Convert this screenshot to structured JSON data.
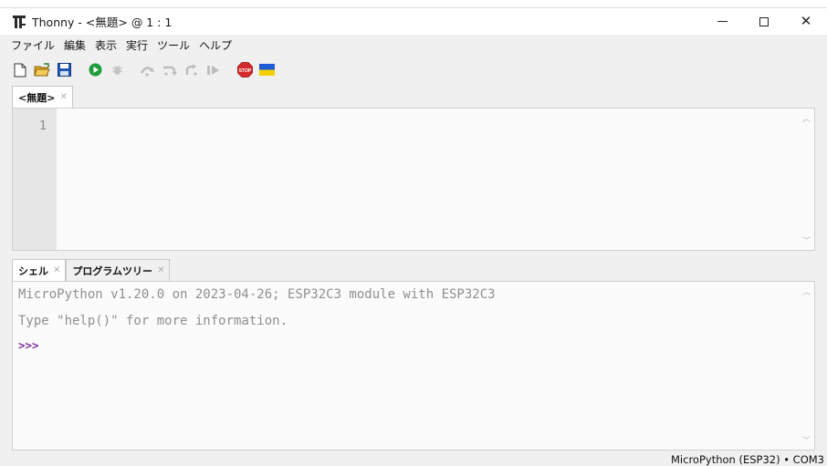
{
  "window": {
    "title": "Thonny  -  <無題>  @  1 : 1"
  },
  "menu": {
    "items": [
      {
        "label": "ファイル"
      },
      {
        "label": "編集"
      },
      {
        "label": "表示"
      },
      {
        "label": "実行"
      },
      {
        "label": "ツール"
      },
      {
        "label": "ヘルプ"
      }
    ]
  },
  "toolbar": {
    "icons": [
      "new-file-icon",
      "open-file-icon",
      "save-icon",
      "run-icon",
      "debug-icon",
      "step-over-icon",
      "step-into-icon",
      "step-out-icon",
      "resume-icon",
      "stop-icon",
      "ukraine-flag-icon"
    ],
    "stop_label": "STOP",
    "colors": {
      "run": "#1f9d3a",
      "stop": "#d62b2b",
      "save": "#2456b4",
      "flag_blue": "#1f5bd6",
      "flag_yellow": "#f5d000"
    }
  },
  "editor": {
    "tab_label": "<無題>",
    "line_numbers": [
      "1"
    ]
  },
  "shell": {
    "tabs": [
      {
        "label": "シェル"
      },
      {
        "label": "プログラムツリー"
      }
    ],
    "lines": [
      "MicroPython v1.20.0 on 2023-04-26; ESP32C3 module with ESP32C3",
      "Type \"help()\" for more information."
    ],
    "prompt": ">>>",
    "prompt_color": "#7e2fa0"
  },
  "status": {
    "text": "MicroPython (ESP32)  •  COM3"
  }
}
